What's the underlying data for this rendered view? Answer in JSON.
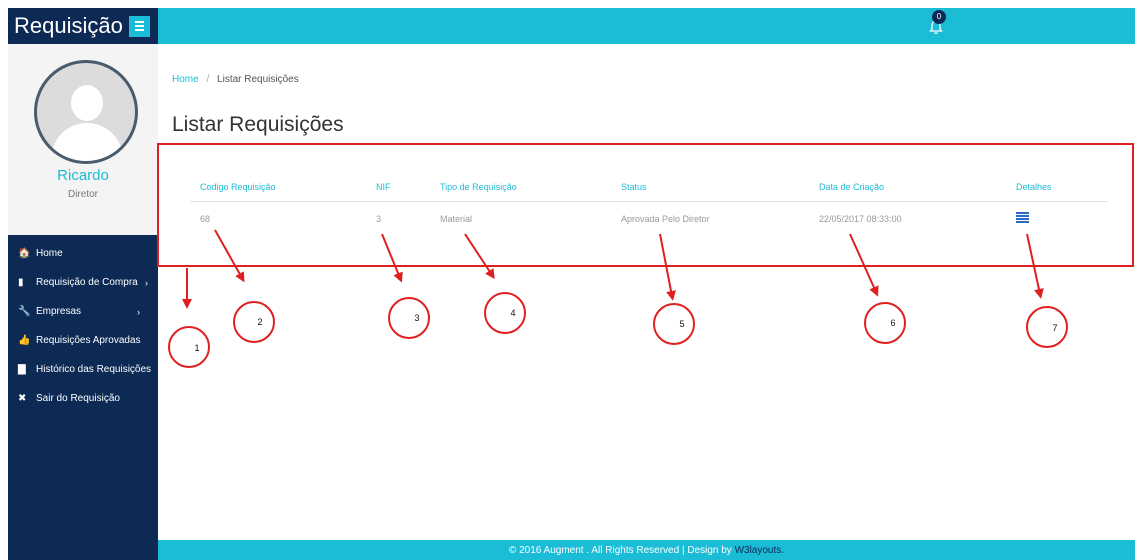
{
  "app": {
    "title": "Requisição"
  },
  "profile": {
    "name": "Ricardo",
    "role": "Diretor"
  },
  "nav": {
    "items": [
      {
        "label": "Home",
        "icon": "home-icon",
        "glyph": "🏠"
      },
      {
        "label": "Requisição de Compra",
        "icon": "file-icon",
        "glyph": "▮"
      },
      {
        "label": "Empresas",
        "icon": "wrench-icon",
        "glyph": "🔧"
      },
      {
        "label": "Requisições Aprovadas",
        "icon": "thumbs-up-icon",
        "glyph": "👍"
      },
      {
        "label": "Histórico das Requisições",
        "icon": "book-icon",
        "glyph": "▇"
      },
      {
        "label": "Sair do Requisição",
        "icon": "close-icon",
        "glyph": "✖"
      }
    ],
    "chevron": "›"
  },
  "topbar": {
    "notifications_count": "0"
  },
  "breadcrumb": {
    "home": "Home",
    "separator": "/",
    "current": "Listar Requisições"
  },
  "page": {
    "title": "Listar Requisições"
  },
  "table": {
    "headers": [
      "Codigo Requisição",
      "NIF",
      "Tipo de Requisição",
      "Status",
      "Data de Criação",
      "Detalhes"
    ],
    "rows": [
      {
        "codigo": "68",
        "nif": "3",
        "tipo": "Material",
        "status": "Aprovada Pelo Diretor",
        "data": "22/05/2017 08:33:00",
        "detalhes_icon": "list-icon"
      }
    ]
  },
  "annotations": {
    "labels": [
      "1",
      "2",
      "3",
      "4",
      "5",
      "6",
      "7"
    ],
    "color": "#e02020"
  },
  "footer": {
    "text": "© 2016 Augment . All Rights Reserved | Design by ",
    "link": "W3layouts."
  },
  "colors": {
    "navy": "#0d2a55",
    "teal": "#1bbcd6",
    "icon_blue": "#2d6bbf"
  }
}
